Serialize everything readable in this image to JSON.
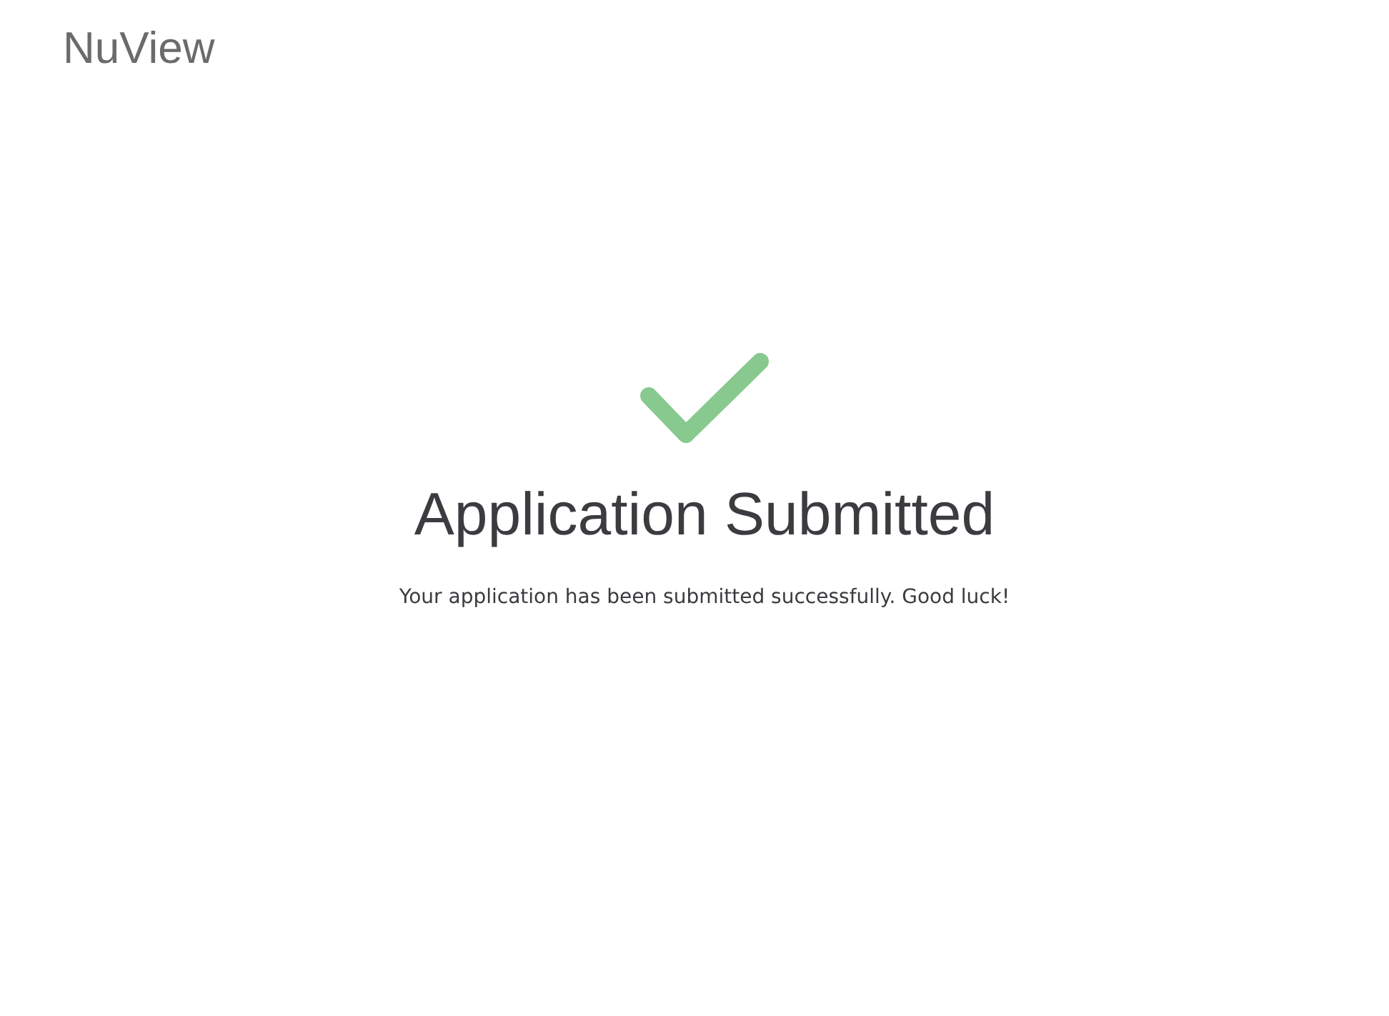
{
  "header": {
    "logo": "NuView"
  },
  "confirmation": {
    "title": "Application Submitted",
    "message": "Your application has been submitted successfully. Good luck!"
  }
}
